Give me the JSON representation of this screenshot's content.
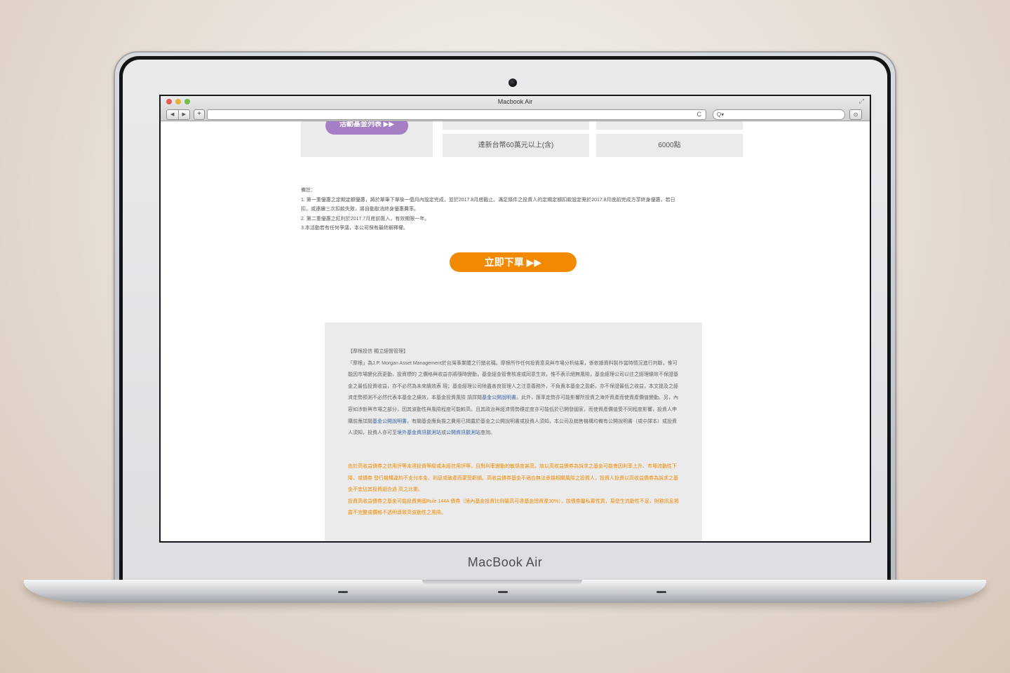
{
  "device": {
    "brand_label": "MacBook Air"
  },
  "browser": {
    "window_title": "Macbook Air",
    "nav_back": "◀",
    "nav_forward": "▶",
    "add_tab": "+",
    "reload": "C",
    "search_glyph": "Q▾",
    "address_value": "",
    "search_value": ""
  },
  "promo": {
    "fund_list_button": "活動基金列表 ▶▶",
    "row_threshold": "達新台幣60萬元以上(含)",
    "row_points": "6000點"
  },
  "notes": {
    "heading": "備註：",
    "lines": [
      "1. 第一重優惠之定期定額優惠，將於單筆下單後一個月內設定完成，並於2017.8月底截止。滿足條件之投資人的定期定額扣款設定需於2017.8月底前完成方享終身優惠，若日",
      "扣，或連續三次扣款失敗，將自動取消終身優惠費率。",
      "2. 第二重優惠之紅利於2017.7月底前匯入，有效期限一年。",
      "3.本活動若有任何爭議，本公司保有最終解釋權。"
    ]
  },
  "order_button": "立即下單 ▶▶",
  "disclaimer": {
    "title": "【摩根投信 獨立經營管理】",
    "p1_start": "「摩根」為J.P. Morgan Asset Management於台灣事業體之行銷名稱。摩根所作任何投資意見與市場分析結果，係依據資料製作當時情況進行判斷，惟可能因市場變化而更動，投資標的 之價格與收益亦將隨時變動，基金經金管會核准或同意生效，惟不表示絕無風險，基金經理公司以往之經理績效不保證基金之最低投資收益，亦不必然為未來績效表 現；基金經理公司除盡善良管理人之注意義務外，不負責本基金之盈虧，亦不保證最低之收益，本文提及之經濟走勢預測不必然代表本基金之績效，本基金投資風險 請詳閱",
    "link1": "基金公開說明書",
    "p1_mid": "。此外，匯率走勢亦可能影響所投資之海外資產而使資產價值變動。另，內容如涉新興市場之部分，因其波動性與風險程度可能較高，且其政治與經濟情勢穩定度亦可能低於已開發國家，而使資產價值受不同程度影響，投資人申購前應詳閱",
    "link2": "基金公開說明書",
    "p1_mid2": "，有關基金應負擔之費用已揭露於基金之公開說明書或投資人須知，本公司及銷售機構均備有公開說明書（或中譯本）或投資人須知，投資人亦可至",
    "link3": "境外基金資訊觀測站",
    "p1_or": "或",
    "link4": "公開資訊觀測站",
    "p1_end": "查詢。",
    "warning1": "由於高收益債券之信用評等未達投資等級或未經信用評等，且對利率變動的敏感度甚高，故以高收益債券為訴求之基金可能會因利率上升、市場流動性下降，或債券 發行機構違約不支付本金、利息或破產而蒙受虧損。高收益債券基金不適合無法承擔相關風險之投資人，投資人投資以高收益債券為訴求之基金不宜佔其投資組合過 高之比重。",
    "warning2": "投資高收益債券之基金可能投資美國Rule 144A 債券（境內基金投資比例最高可達基金總資產30%），該債券屬私募性質，易發生流動性不足，財務訊息揭露不完整或價格不透明導致高波動性之風險。"
  }
}
